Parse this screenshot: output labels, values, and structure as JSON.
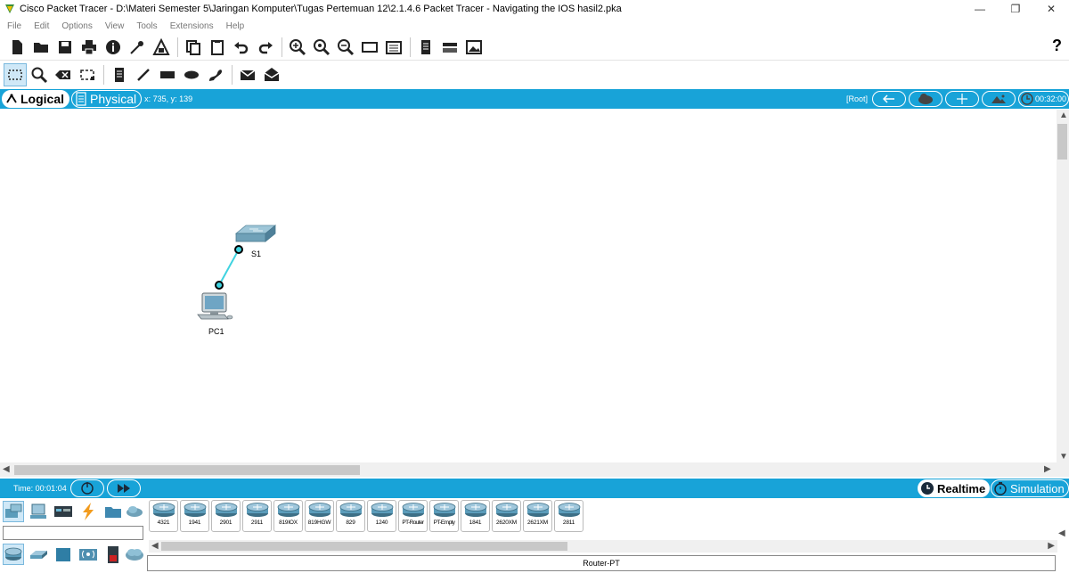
{
  "window": {
    "title": "Cisco Packet Tracer - D:\\Materi Semester 5\\Jaringan Komputer\\Tugas Pertemuan 12\\2.1.4.6 Packet Tracer - Navigating the IOS hasil2.pka",
    "minimize": "—",
    "restore": "❐",
    "close": "✕"
  },
  "menu": [
    "File",
    "Edit",
    "Options",
    "View",
    "Tools",
    "Extensions",
    "Help"
  ],
  "toolbar": {
    "help": "?",
    "buttons": [
      "new-file-icon",
      "open-icon",
      "save-icon",
      "print-icon",
      "info-icon",
      "activity-wizard-icon",
      "pdu-icon",
      "copy-icon",
      "paste-icon",
      "undo-icon",
      "redo-icon",
      "zoom-in-icon",
      "zoom-reset-icon",
      "zoom-out-icon",
      "drawing-palette-icon",
      "custom-device-icon",
      "notes-icon",
      "device-dialog-icon",
      "image-icon"
    ]
  },
  "tools": [
    "select-icon",
    "inspect-icon",
    "delete-icon",
    "resize-icon",
    "note-icon",
    "line-icon",
    "rectangle-icon",
    "ellipse-icon",
    "freeform-icon",
    "simple-pdu-icon",
    "complex-pdu-icon"
  ],
  "viewbar": {
    "logical": "Logical",
    "physical": "Physical",
    "coords": "x: 735, y: 139",
    "root": "[Root]",
    "time": "00:32:00"
  },
  "devices": {
    "switch_label": "S1",
    "pc_label": "PC1"
  },
  "timebar": {
    "time": "Time: 00:01:04",
    "realtime": "Realtime",
    "simulation": "Simulation"
  },
  "categories": [
    "network-devices-icon",
    "end-devices-icon",
    "components-icon",
    "connections-icon",
    "miscellaneous-icon",
    "multiuser-icon"
  ],
  "subcategories": [
    "routers-icon",
    "switches-icon",
    "hubs-icon",
    "wireless-icon",
    "security-icon",
    "wan-emulation-icon"
  ],
  "models": [
    "4321",
    "1941",
    "2901",
    "2911",
    "819IOX",
    "819HGW",
    "829",
    "1240",
    "PT-Router",
    "PT-Empty",
    "1841",
    "2620XM",
    "2621XM",
    "2811"
  ],
  "status": "Router-PT",
  "colors": {
    "accent": "#18a3d8",
    "link": "#3fd3e0"
  }
}
